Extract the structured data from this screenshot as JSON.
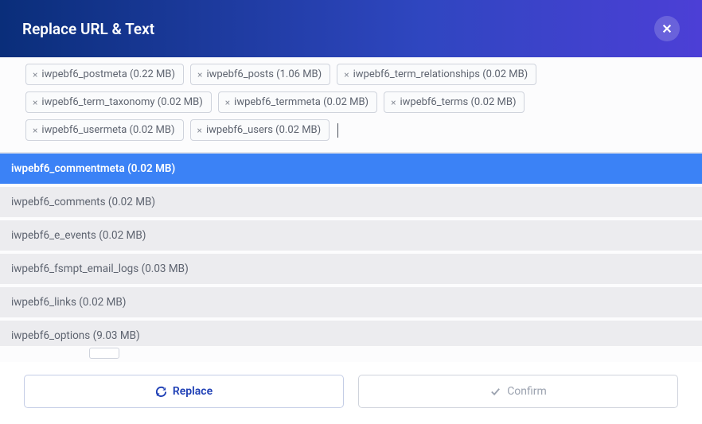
{
  "header": {
    "title": "Replace URL & Text"
  },
  "tags": [
    {
      "label": "iwpebf6_postmeta (0.22 MB)"
    },
    {
      "label": "iwpebf6_posts (1.06 MB)"
    },
    {
      "label": "iwpebf6_term_relationships (0.02 MB)"
    },
    {
      "label": "iwpebf6_term_taxonomy (0.02 MB)"
    },
    {
      "label": "iwpebf6_termmeta (0.02 MB)"
    },
    {
      "label": "iwpebf6_terms (0.02 MB)"
    },
    {
      "label": "iwpebf6_usermeta (0.02 MB)"
    },
    {
      "label": "iwpebf6_users (0.02 MB)"
    }
  ],
  "available_tables": [
    {
      "label": "iwpebf6_commentmeta (0.02 MB)",
      "selected": true
    },
    {
      "label": "iwpebf6_comments (0.02 MB)",
      "selected": false
    },
    {
      "label": "iwpebf6_e_events (0.02 MB)",
      "selected": false
    },
    {
      "label": "iwpebf6_fsmpt_email_logs (0.03 MB)",
      "selected": false
    },
    {
      "label": "iwpebf6_links (0.02 MB)",
      "selected": false
    },
    {
      "label": "iwpebf6_options (9.03 MB)",
      "selected": false
    }
  ],
  "footer": {
    "replace_label": "Replace",
    "confirm_label": "Confirm"
  }
}
